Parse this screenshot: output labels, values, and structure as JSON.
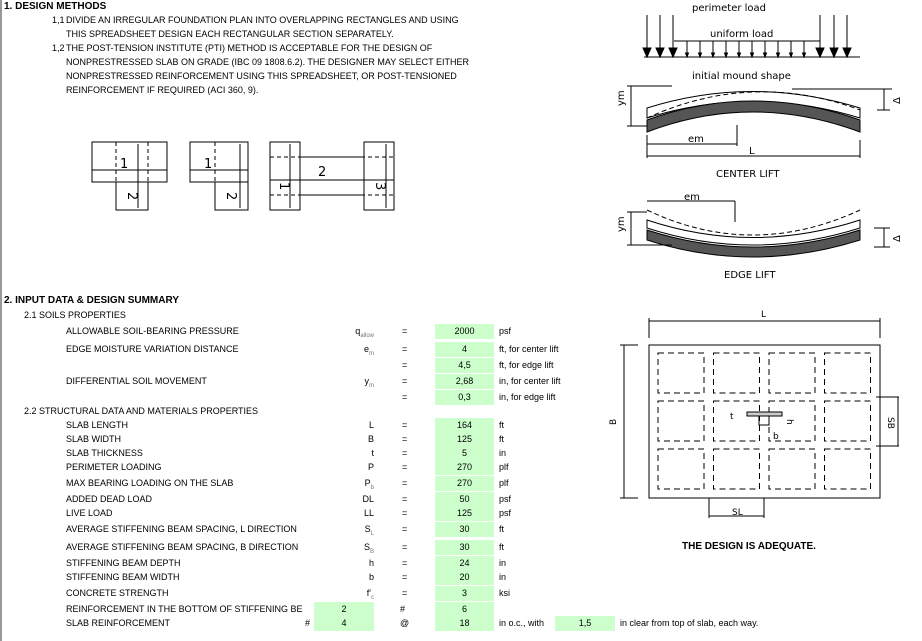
{
  "section1": {
    "title": "1. DESIGN METHODS",
    "items": [
      {
        "num": "1,1",
        "lines": [
          "DIVIDE AN IRREGULAR FOUNDATION PLAN INTO OVERLAPPING RECTANGLES AND  USING",
          "THIS SPREADSHEET DESIGN EACH RECTANGULAR SECTION SEPARATELY."
        ]
      },
      {
        "num": "1,2",
        "lines": [
          "THE POST-TENSION INSTITUTE (PTI) METHOD IS ACCEPTABLE FOR THE DESIGN OF",
          "NONPRESTRESSED SLAB ON GRADE (IBC 09 1808.6.2). THE DESIGNER MAY SELECT EITHER",
          "NONPRESTRESSED REINFORCEMENT USING THIS SPREADSHEET, OR POST-TENSIONED",
          "REINFORCEMENT IF REQUIRED (ACI 360, 9)."
        ]
      }
    ]
  },
  "plan_diagrams": {
    "labels": [
      "1",
      "2",
      "1",
      "2",
      "1",
      "2",
      "3"
    ]
  },
  "load_diagram": {
    "perimeter": "perimeter  load",
    "uniform": "uniform  load",
    "mound": "initial  mound  shape",
    "em": "em",
    "L": "L",
    "ym": "ym",
    "delta": "Δ",
    "center_caption": "CENTER  LIFT",
    "edge_caption": "EDGE  LIFT"
  },
  "slab_plan": {
    "L": "L",
    "B": "B",
    "SL": "SL",
    "SB": "SB",
    "t": "t",
    "h": "h",
    "b": "b"
  },
  "section2": {
    "title": "2. INPUT DATA & DESIGN SUMMARY",
    "soils_title": "2.1 SOILS PROPERTIES",
    "struct_title": "2.2 STRUCTURAL DATA AND MATERIALS PROPERTIES",
    "eq": "=",
    "soils": [
      {
        "label": "ALLOWABLE SOIL-BEARING PRESSURE",
        "sym": "q",
        "sub": "allow",
        "value": "2000",
        "unit": "psf"
      },
      {
        "label": "EDGE MOISTURE VARIATION DISTANCE",
        "sym": "e",
        "sub": "m",
        "value": "4",
        "unit": "ft, for center lift"
      },
      {
        "label": "",
        "sym": "",
        "sub": "",
        "value": "4,5",
        "unit": "ft, for edge lift"
      },
      {
        "label": "DIFFERENTIAL SOIL MOVEMENT",
        "sym": "y",
        "sub": "m",
        "value": "2,68",
        "unit": "in, for center lift"
      },
      {
        "label": "",
        "sym": "",
        "sub": "",
        "value": "0,3",
        "unit": "in, for edge lift"
      }
    ],
    "struct": [
      {
        "label": "SLAB LENGTH",
        "sym": "L",
        "sub": "",
        "value": "164",
        "unit": "ft"
      },
      {
        "label": "SLAB WIDTH",
        "sym": "B",
        "sub": "",
        "value": "125",
        "unit": "ft"
      },
      {
        "label": "SLAB THICKNESS",
        "sym": "t",
        "sub": "",
        "value": "5",
        "unit": "in"
      },
      {
        "label": "PERIMETER LOADING",
        "sym": "P",
        "sub": "",
        "value": "270",
        "unit": "plf"
      },
      {
        "label": "MAX BEARING LOADING ON THE SLAB",
        "sym": "P",
        "sub": "b",
        "value": "270",
        "unit": "plf"
      },
      {
        "label": "ADDED DEAD LOAD",
        "sym": "DL",
        "sub": "",
        "value": "50",
        "unit": "psf"
      },
      {
        "label": "LIVE LOAD",
        "sym": "LL",
        "sub": "",
        "value": "125",
        "unit": "psf"
      },
      {
        "label": "AVERAGE STIFFENING BEAM SPACING, L DIRECTION",
        "sym": "S",
        "sub": "L",
        "value": "30",
        "unit": "ft"
      },
      {
        "label": "AVERAGE STIFFENING BEAM SPACING, B DIRECTION",
        "sym": "S",
        "sub": "B",
        "value": "30",
        "unit": "ft"
      },
      {
        "label": "STIFFENING BEAM DEPTH",
        "sym": "h",
        "sub": "",
        "value": "24",
        "unit": "in"
      },
      {
        "label": "STIFFENING BEAM WIDTH",
        "sym": "b",
        "sub": "",
        "value": "20",
        "unit": "in"
      },
      {
        "label": "CONCRETE STRENGTH",
        "sym": "f'",
        "sub": "c",
        "value": "3",
        "unit": "ksi"
      }
    ],
    "beam_reinf": {
      "label": "REINFORCEMENT IN THE BOTTOM OF STIFFENING BE",
      "count": "2",
      "hash": "#",
      "bar": "6"
    },
    "slab_reinf": {
      "label": "SLAB REINFORCEMENT",
      "hash": "#",
      "bar": "4",
      "at": "@",
      "spacing": "18",
      "unit": "in o.c., with",
      "clear": "1,5",
      "clear_unit": "in clear from top of slab, each way."
    },
    "result": "THE DESIGN IS ADEQUATE."
  },
  "colors": {
    "input_cell": "#ccffcc"
  }
}
